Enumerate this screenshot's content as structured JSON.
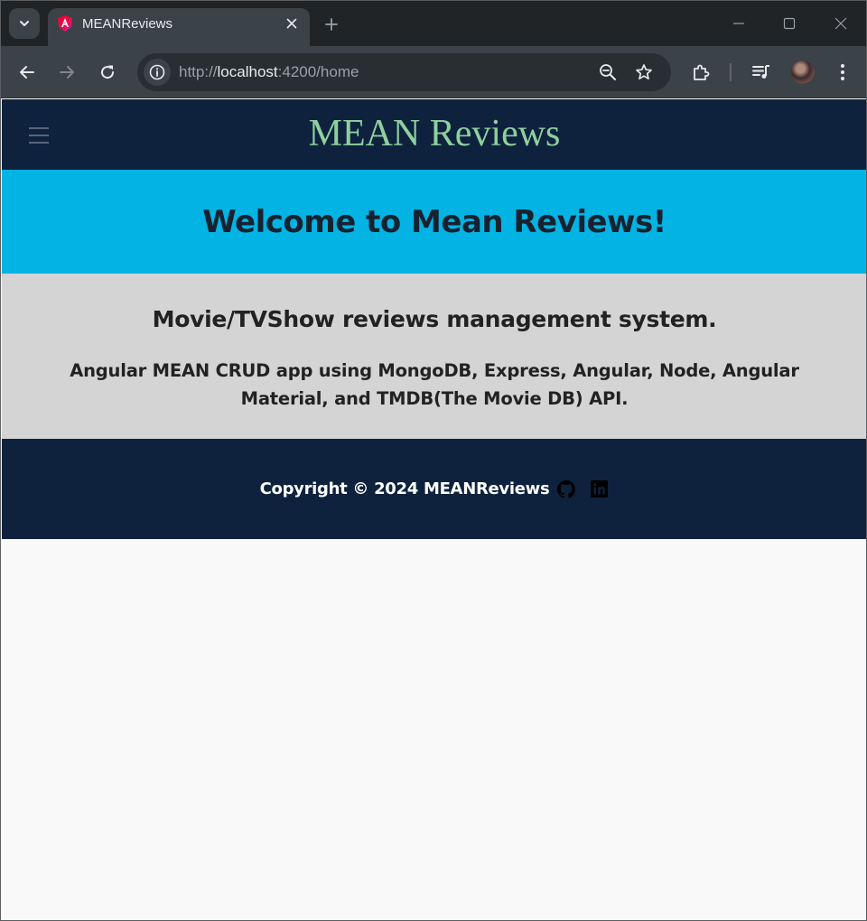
{
  "browser": {
    "tab": {
      "title": "MEANReviews",
      "favicon": "angular-icon"
    },
    "address_bar": {
      "scheme": "http://",
      "host": "localhost",
      "rest": ":4200/home"
    }
  },
  "app": {
    "header": {
      "title": "MEAN Reviews",
      "menu_icon": "hamburger-menu-icon"
    },
    "welcome": {
      "heading": "Welcome to Mean Reviews!"
    },
    "info": {
      "subheading": "Movie/TVShow reviews management system.",
      "description": "Angular MEAN CRUD app using MongoDB, Express, Angular, Node, Angular Material, and TMDB(The Movie DB) API."
    },
    "footer": {
      "copyright": "Copyright © 2024 MEANReviews",
      "icons": [
        "github-icon",
        "linkedin-icon"
      ]
    }
  },
  "colors": {
    "header_bg": "#0e223e",
    "title_color": "#8fcf9e",
    "welcome_bg": "#02b3e3",
    "info_bg": "#d4d4d4",
    "footer_bg": "#0e223e",
    "page_bg": "#f9f9f9"
  }
}
